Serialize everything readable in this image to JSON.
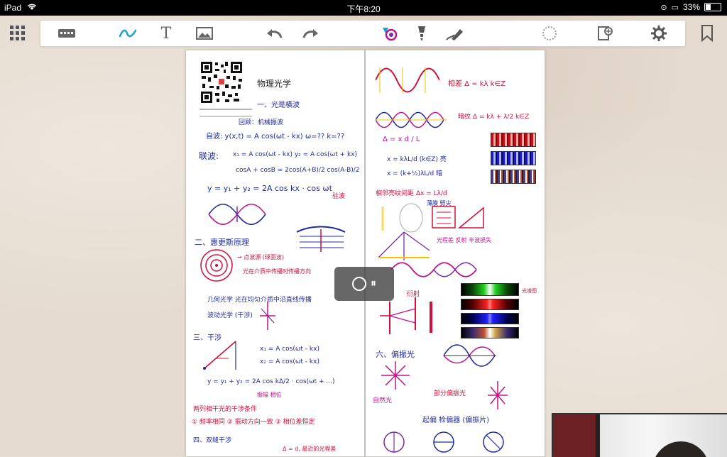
{
  "status_bar": {
    "device": "iPad",
    "time": "下午8:20",
    "battery": "33%"
  },
  "toolbar": {
    "tools": [
      "grid-icon",
      "keyboard-icon",
      "pen-icon",
      "text-icon",
      "image-icon",
      "undo-icon",
      "redo-icon",
      "color-palette-icon",
      "highlighter-icon",
      "eraser-icon",
      "lasso-icon",
      "add-page-icon",
      "settings-icon",
      "bookmark-icon"
    ],
    "text_tool_label": "T"
  },
  "notes": {
    "left": {
      "title": "物理光学",
      "section1": "一、光是横波",
      "caption1": "回顾：机械振波",
      "eq_wave": "自波: y(x,t) = A cos(ωt - kx)   ω=??  k=??",
      "eq_combined_label": "联波:",
      "eq_combined": "x₁ = A cos(ωt - kx)   y₂ = A cos(ωt + kx)",
      "eq_identity": "cosA + cosB = 2cos(A+B)/2 cos(A-B)/2",
      "eq_sum": "y = y₁ + y₂ = 2A cos kx · cos ωt",
      "eq_sum_note": "驻波",
      "section2": "二、惠更斯原理",
      "section2_note": "→ 点波源 (球面波)",
      "note_a": "光在介质中传播时传播方向",
      "note_b": "几何光学  光在均匀介质中沿直线传播",
      "note_c": "波动光学  (干涉)",
      "section3": "三、干涉",
      "eq_x1": "x₁ = A cos(ωt - kx)",
      "eq_x2": "x₂ = A cos(ωt - kx)",
      "eq_x": "y = y₁ + y₂ = 2A cos kΔ/2 · cos(ωt + ...)",
      "eq_x_notes": "振幅   相位",
      "interference_title": "两列相干光的干涉条件",
      "conditions": "① 频率相同  ② 振动方向一致  ③ 相位差恒定",
      "section4": "四、双缝干涉",
      "bottom_eq": "Δ = d, 最近的光程差"
    },
    "right": {
      "eq_top": "相差 Δ = kλ  k∈Z",
      "eq_dark": "暗纹 Δ = kλ + λ/2  k∈Z",
      "eq_delta": "Δ = x d / L",
      "eq_bright": "x = kλL/d  (k∈Z) 亮",
      "eq_dark2": "x = (k+½)λL/d  暗",
      "note_fringe": "相邻亮纹间距  Δx = Lλ/d",
      "note_thin": "薄膜  劈尖",
      "note_multi": "光程差  反射  半波损失",
      "section_diff": "衍射",
      "section6": "六、偏振光",
      "polarizer": "起偏  检偏器 (偏振片)",
      "partial": "部分偏振光",
      "nat": "自然光",
      "spectrum_caption": "光谱图",
      "colors": [
        "#1f2a9a",
        "#d0103a",
        "#c0128a",
        "#7a2aa8"
      ]
    }
  },
  "overlay": {
    "icon": "recording-icon",
    "label": "⏸"
  }
}
